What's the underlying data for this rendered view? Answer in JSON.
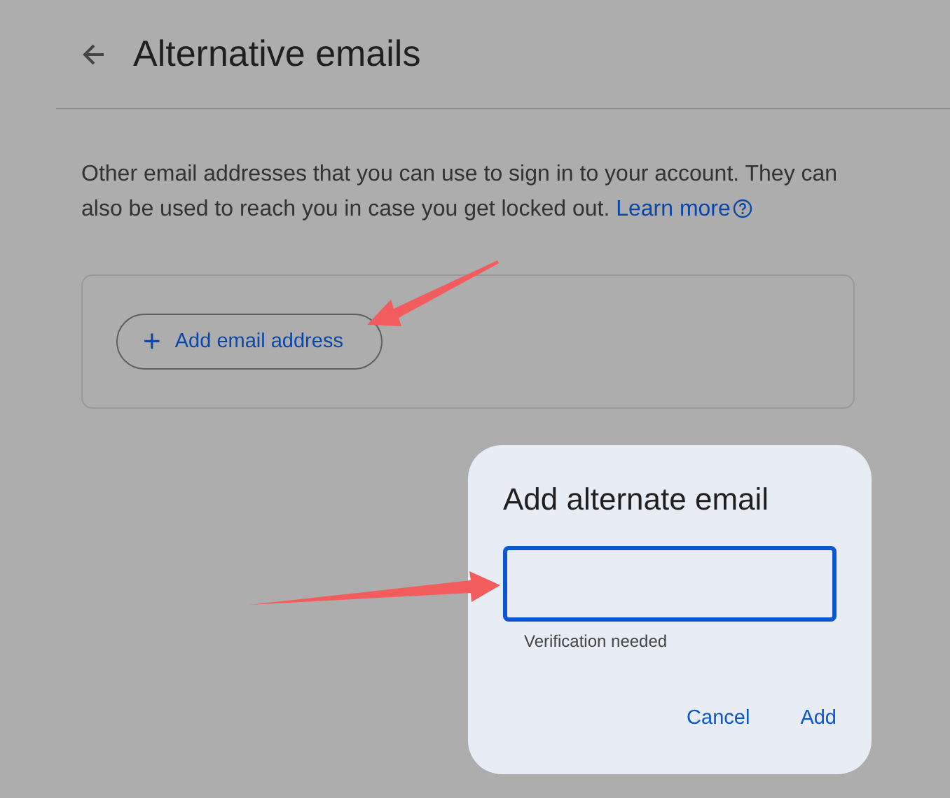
{
  "header": {
    "title": "Alternative emails"
  },
  "description": {
    "text": "Other email addresses that you can use to sign in to your account. They can also be used to reach you in case you get locked out.",
    "link": "Learn more"
  },
  "card": {
    "button": {
      "icon": "+",
      "label": "Add email address"
    }
  },
  "dialog": {
    "title": "Add alternate email",
    "field": {
      "focused": true
    },
    "helper": "Verification needed",
    "buttons": [
      {
        "label": "Cancel"
      },
      {
        "label": "Add"
      }
    ]
  }
}
